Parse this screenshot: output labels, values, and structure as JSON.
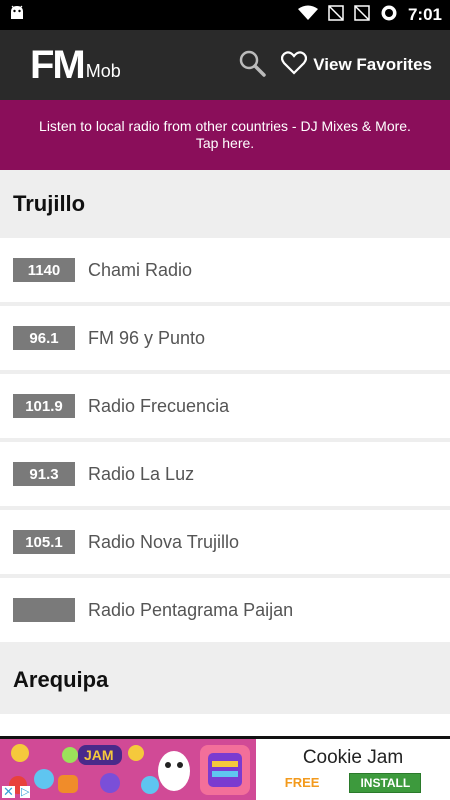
{
  "statusbar": {
    "time": "7:01",
    "icons": [
      "android-icon",
      "wifi-icon",
      "no-signal-icon",
      "no-signal-icon",
      "alarm-icon"
    ]
  },
  "appbar": {
    "logo_main": "FM",
    "logo_sub": "Mob",
    "search_icon": "search-icon",
    "favorites_label": "View Favorites"
  },
  "promo": {
    "line1": "Listen to local radio from other countries - DJ Mixes & More.",
    "line2": "Tap here."
  },
  "sections": [
    {
      "title": "Trujillo",
      "stations": [
        {
          "freq": "1140",
          "name": "Chami Radio"
        },
        {
          "freq": "96.1",
          "name": "FM 96 y Punto"
        },
        {
          "freq": "101.9",
          "name": "Radio Frecuencia"
        },
        {
          "freq": "91.3",
          "name": "Radio La Luz"
        },
        {
          "freq": "105.1",
          "name": "Radio Nova Trujillo"
        },
        {
          "freq": "",
          "name": "Radio Pentagrama Paijan"
        }
      ]
    },
    {
      "title": "Arequipa",
      "stations": []
    }
  ],
  "ad": {
    "image_text": "JAM",
    "title": "Cookie Jam",
    "free_label": "FREE",
    "install_label": "INSTALL"
  },
  "colors": {
    "appbar": "#2a2a2a",
    "promo": "#8a0e5a",
    "freq_badge": "#7a7a7a",
    "install": "#3d9a3d",
    "free": "#f39a1c"
  }
}
